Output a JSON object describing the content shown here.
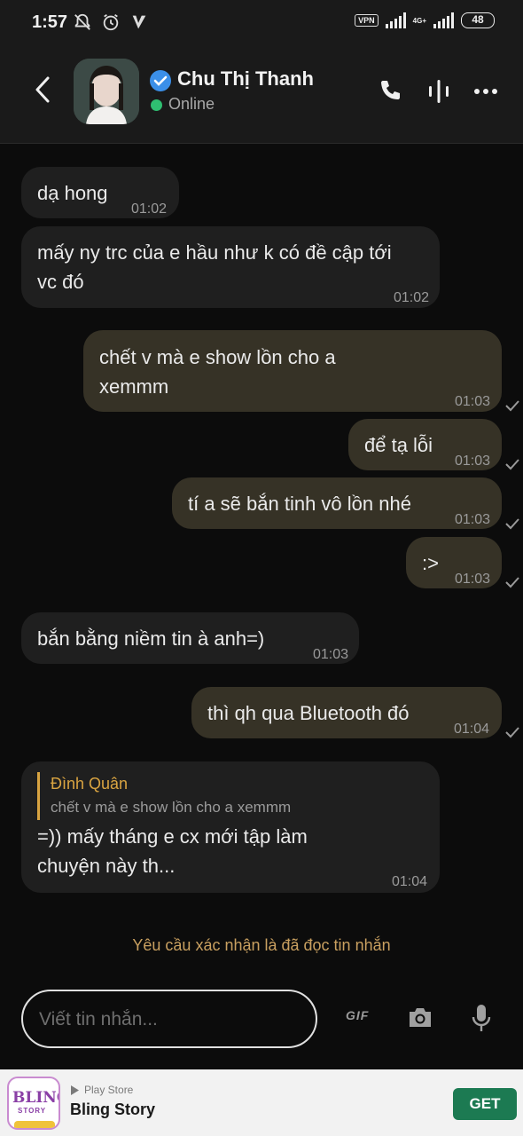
{
  "status_bar": {
    "time": "1:57",
    "vpn": "VPN",
    "network": "4G+",
    "battery": "48"
  },
  "header": {
    "name": "Chu Thị Thanh",
    "status": "Online"
  },
  "messages": [
    {
      "dir": "in",
      "text": "dạ hong",
      "time": "01:02"
    },
    {
      "dir": "in",
      "text": "mấy ny trc của e hầu như k có đề cập tới vc đó",
      "time": "01:02"
    },
    {
      "dir": "out",
      "text": "chết v mà e show lồn cho a xemmm",
      "time": "01:03"
    },
    {
      "dir": "out",
      "text": "để tạ lỗi",
      "time": "01:03"
    },
    {
      "dir": "out",
      "text": "tí a sẽ bắn tinh vô lồn nhé",
      "time": "01:03"
    },
    {
      "dir": "out",
      "text": ":>",
      "time": "01:03"
    },
    {
      "dir": "in",
      "text": "bắn bằng niềm tin à anh=)",
      "time": "01:03"
    },
    {
      "dir": "out",
      "text": "thì qh qua Bluetooth đó",
      "time": "01:04"
    },
    {
      "dir": "in",
      "reply_author": "Đình Quân",
      "reply_text": "chết v mà e show lồn cho a xemmm",
      "text": "=)) mấy tháng e cx mới tập làm chuyện này th...",
      "time": "01:04"
    }
  ],
  "read_receipt_text": "Yêu cầu xác nhận là đã đọc tin nhắn",
  "composer": {
    "placeholder": "Viết tin nhắn...",
    "gif_label": "GIF"
  },
  "ad": {
    "logo_line1": "BLING",
    "logo_line2": "STORY",
    "source": "Play Store",
    "title": "Bling Story",
    "cta": "GET"
  },
  "colors": {
    "outgoing_bubble": "#363226",
    "incoming_bubble": "#1f1f1f",
    "accent_gold": "#d9a441",
    "online_green": "#2fbf71",
    "verified_blue": "#3b8fe8",
    "ad_button": "#1c7a52"
  },
  "icons": [
    "back-icon",
    "verified-icon",
    "phone-icon",
    "voice-wave-icon",
    "more-icon",
    "gif-icon",
    "camera-icon",
    "mic-icon",
    "play-store-icon",
    "check-icon"
  ]
}
